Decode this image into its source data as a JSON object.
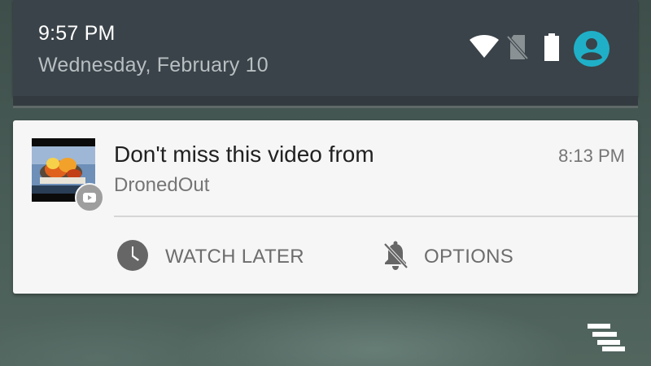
{
  "status_bar": {
    "time": "9:57 PM",
    "date": "Wednesday, February 10",
    "icons": [
      "wifi-icon",
      "no-sim-icon",
      "battery-icon",
      "account-avatar-icon"
    ],
    "avatar_color": "#1fb0c8"
  },
  "notification": {
    "title": "Don't miss this video from",
    "channel": "DronedOut",
    "time": "8:13 PM",
    "app_badge_icon": "youtube-icon",
    "thumbnail_description_icon": "video-thumbnail",
    "actions": [
      {
        "label": "WATCH LATER",
        "icon": "clock-icon"
      },
      {
        "label": "OPTIONS",
        "icon": "bell-off-icon"
      }
    ]
  },
  "shade_handle_icon": "notification-stack-icon",
  "colors": {
    "shade_background": "#3a4349",
    "card_background": "#f6f6f6",
    "title_text": "#212121",
    "secondary_text": "#757575"
  }
}
